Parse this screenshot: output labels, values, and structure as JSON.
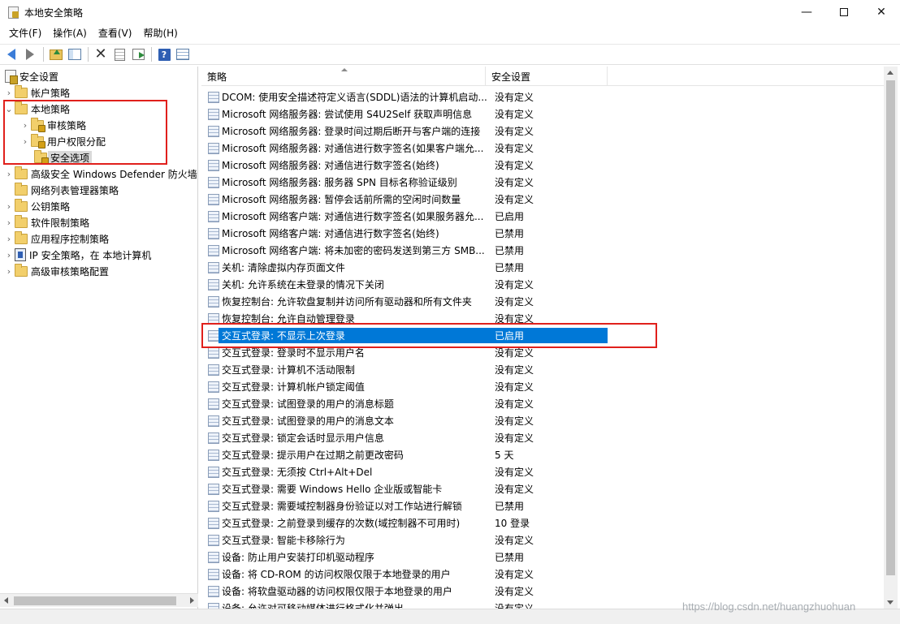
{
  "window": {
    "title": "本地安全策略",
    "minimize_glyph": "—",
    "close_glyph": "✕"
  },
  "menu": [
    "文件(F)",
    "操作(A)",
    "查看(V)",
    "帮助(H)"
  ],
  "toolbar": {
    "icons": [
      "back-arrow-icon",
      "forward-arrow-icon",
      "up-folder-icon",
      "show-tree-icon",
      "delete-icon",
      "properties-icon",
      "export-list-icon",
      "help-icon",
      "details-view-icon"
    ],
    "delete_glyph": "✕",
    "help_glyph": "?"
  },
  "tree": [
    {
      "label": "安全设置",
      "expanded": true,
      "icon": "book-icon"
    },
    {
      "label": "帐户策略",
      "expanded": false,
      "icon": "folder-icon"
    },
    {
      "label": "本地策略",
      "expanded": true,
      "icon": "folder-icon"
    },
    {
      "label": "审核策略",
      "expanded": false,
      "icon": "folder-icon"
    },
    {
      "label": "用户权限分配",
      "expanded": false,
      "icon": "folder-icon"
    },
    {
      "label": "安全选项",
      "selected": true,
      "icon": "folder-icon"
    },
    {
      "label": "高级安全 Windows Defender 防火墙",
      "expanded": false,
      "icon": "folder-icon"
    },
    {
      "label": "网络列表管理器策略",
      "icon": "folder-icon"
    },
    {
      "label": "公钥策略",
      "expanded": false,
      "icon": "folder-icon"
    },
    {
      "label": "软件限制策略",
      "expanded": false,
      "icon": "folder-icon"
    },
    {
      "label": "应用程序控制策略",
      "expanded": false,
      "icon": "folder-icon"
    },
    {
      "label": "IP 安全策略，在 本地计算机",
      "expanded": false,
      "icon": "ip-policy-icon"
    },
    {
      "label": "高级审核策略配置",
      "expanded": false,
      "icon": "folder-icon"
    }
  ],
  "list": {
    "columns": [
      "策略",
      "安全设置"
    ],
    "sort_caret": "^",
    "rows": [
      {
        "policy": "DCOM: 使用安全描述符定义语言(SDDL)语法的计算机启动...",
        "setting": "没有定义"
      },
      {
        "policy": "Microsoft 网络服务器: 尝试使用 S4U2Self 获取声明信息",
        "setting": "没有定义"
      },
      {
        "policy": "Microsoft 网络服务器: 登录时间过期后断开与客户端的连接",
        "setting": "没有定义"
      },
      {
        "policy": "Microsoft 网络服务器: 对通信进行数字签名(如果客户端允...",
        "setting": "没有定义"
      },
      {
        "policy": "Microsoft 网络服务器: 对通信进行数字签名(始终)",
        "setting": "没有定义"
      },
      {
        "policy": "Microsoft 网络服务器: 服务器 SPN 目标名称验证级别",
        "setting": "没有定义"
      },
      {
        "policy": "Microsoft 网络服务器: 暂停会话前所需的空闲时间数量",
        "setting": "没有定义"
      },
      {
        "policy": "Microsoft 网络客户端: 对通信进行数字签名(如果服务器允...",
        "setting": "已启用"
      },
      {
        "policy": "Microsoft 网络客户端: 对通信进行数字签名(始终)",
        "setting": "已禁用"
      },
      {
        "policy": "Microsoft 网络客户端: 将未加密的密码发送到第三方 SMB...",
        "setting": "已禁用"
      },
      {
        "policy": "关机: 清除虚拟内存页面文件",
        "setting": "已禁用"
      },
      {
        "policy": "关机: 允许系统在未登录的情况下关闭",
        "setting": "没有定义"
      },
      {
        "policy": "恢复控制台: 允许软盘复制并访问所有驱动器和所有文件夹",
        "setting": "没有定义"
      },
      {
        "policy": "恢复控制台: 允许自动管理登录",
        "setting": "没有定义"
      },
      {
        "policy": "交互式登录: 不显示上次登录",
        "setting": "已启用",
        "highlight": true
      },
      {
        "policy": "交互式登录: 登录时不显示用户名",
        "setting": "没有定义"
      },
      {
        "policy": "交互式登录: 计算机不活动限制",
        "setting": "没有定义"
      },
      {
        "policy": "交互式登录: 计算机帐户锁定阈值",
        "setting": "没有定义"
      },
      {
        "policy": "交互式登录: 试图登录的用户的消息标题",
        "setting": "没有定义"
      },
      {
        "policy": "交互式登录: 试图登录的用户的消息文本",
        "setting": "没有定义"
      },
      {
        "policy": "交互式登录: 锁定会话时显示用户信息",
        "setting": "没有定义"
      },
      {
        "policy": "交互式登录: 提示用户在过期之前更改密码",
        "setting": "5 天"
      },
      {
        "policy": "交互式登录: 无须按 Ctrl+Alt+Del",
        "setting": "没有定义"
      },
      {
        "policy": "交互式登录: 需要 Windows Hello 企业版或智能卡",
        "setting": "没有定义"
      },
      {
        "policy": "交互式登录: 需要域控制器身份验证以对工作站进行解锁",
        "setting": "已禁用"
      },
      {
        "policy": "交互式登录: 之前登录到缓存的次数(域控制器不可用时)",
        "setting": "10 登录"
      },
      {
        "policy": "交互式登录: 智能卡移除行为",
        "setting": "没有定义"
      },
      {
        "policy": "设备: 防止用户安装打印机驱动程序",
        "setting": "已禁用"
      },
      {
        "policy": "设备: 将 CD-ROM 的访问权限仅限于本地登录的用户",
        "setting": "没有定义"
      },
      {
        "policy": "设备: 将软盘驱动器的访问权限仅限于本地登录的用户",
        "setting": "没有定义"
      },
      {
        "policy": "设备: 允许对可移动媒体进行格式化并弹出",
        "setting": "没有定义"
      }
    ]
  },
  "watermark": "https://blog.csdn.net/huangzhuohuan",
  "colors": {
    "selection": "#0078d7",
    "annotation": "#e0201c",
    "folder": "#f2cf6b"
  }
}
